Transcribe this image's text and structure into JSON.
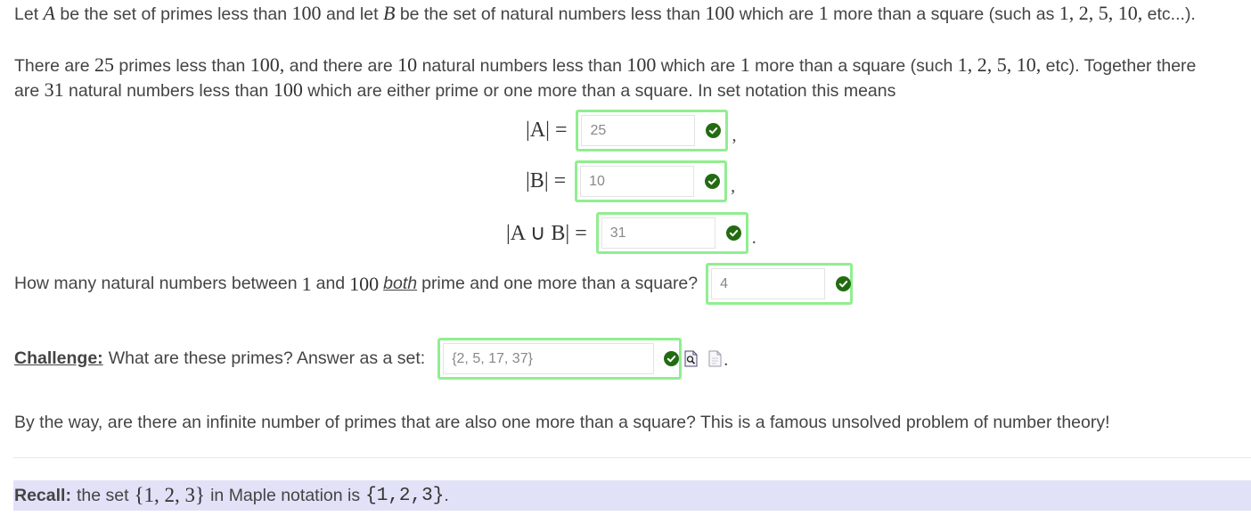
{
  "intro": {
    "let": "Let",
    "A": "A",
    "be_primes": "be the set of primes less than",
    "n100": "100",
    "and_let": "and let",
    "B": "B",
    "be_naturals": "be the set of natural numbers less than",
    "which_are": "which are",
    "one": "1",
    "more_than_sq": "more than a square (such as",
    "examples_math": "1, 2, 5, 10,",
    "etc": "etc...)."
  },
  "para": {
    "l1_a": "There are",
    "l1_25": "25",
    "l1_b": "primes less than",
    "l1_100a": "100,",
    "l1_c": "and there are",
    "l1_10": "10",
    "l1_d": "natural numbers less than",
    "l1_100b": "100",
    "l1_e": "which are",
    "l1_1": "1",
    "l1_f": "more than a square (such",
    "l1_list": "1, 2, 5, 10,",
    "l1_g": "etc). Together there",
    "l2_a": "are",
    "l2_31": "31",
    "l2_b": "natural numbers less than",
    "l2_100": "100",
    "l2_c": "which are either prime or one more than a square. In set notation this means"
  },
  "equations": [
    {
      "lhs": "|A| =",
      "value": "25",
      "punct": ","
    },
    {
      "lhs": "|B| =",
      "value": "10",
      "punct": ","
    },
    {
      "lhs": "|A ∪ B| =",
      "value": "31",
      "punct": "."
    }
  ],
  "question": {
    "a": "How many natural numbers between",
    "n1": "1",
    "and": "and",
    "n100": "100",
    "both": "both",
    "b": "prime and one more than a square?",
    "value": "4"
  },
  "challenge": {
    "label": "Challenge:",
    "text": "What are these primes? Answer as a set:",
    "value": "{2, 5, 17, 37}",
    "punct": "."
  },
  "note": {
    "text": "By the way, are there an infinite number of primes that are also one more than a square? This is a famous unsolved problem of number theory!"
  },
  "recall": {
    "label": "Recall:",
    "a": "the set",
    "set_math": "{1, 2, 3}",
    "b": "in Maple notation is",
    "maple": "{1,2,3}",
    "end": "."
  },
  "colors": {
    "correct_border": "#90ee90",
    "check_fill": "#236b12",
    "recall_bg": "#e1e1f7"
  },
  "icons": [
    "check-icon",
    "preview-document-icon",
    "blank-document-icon"
  ]
}
